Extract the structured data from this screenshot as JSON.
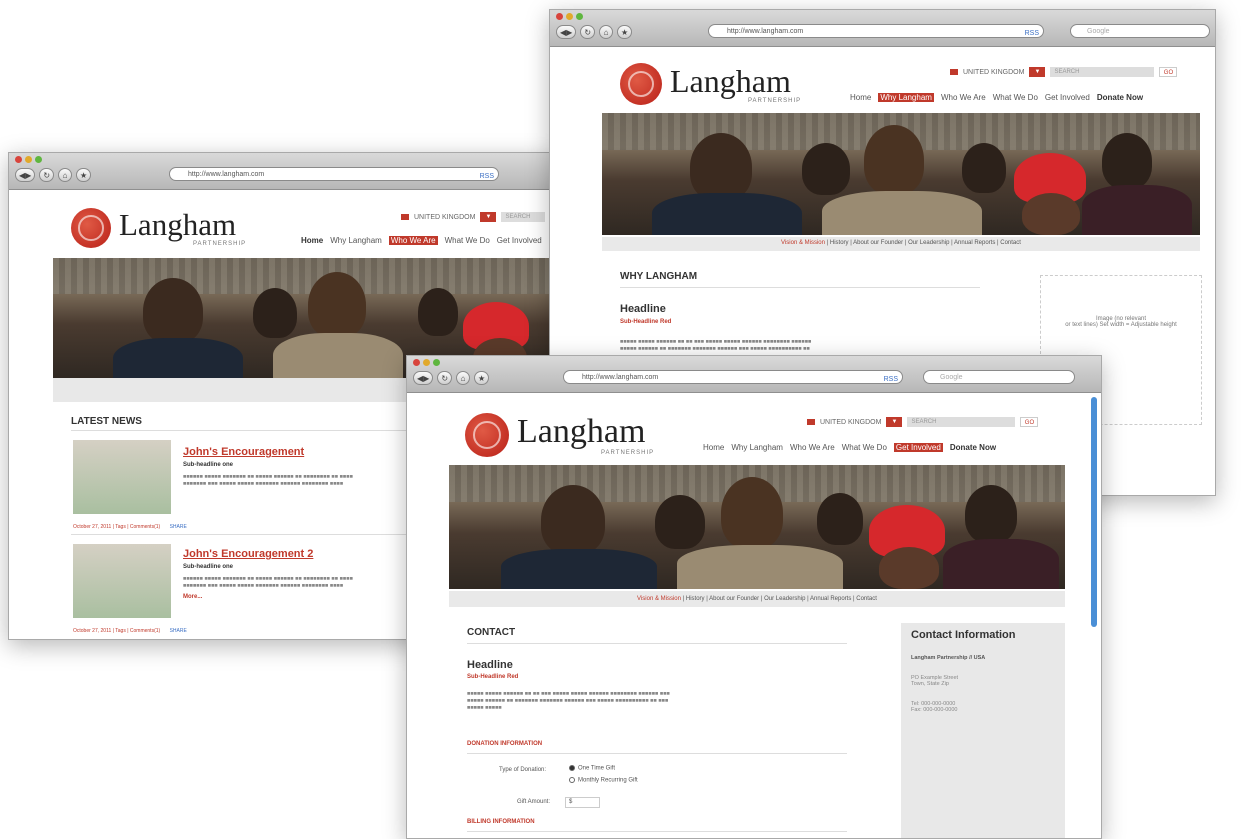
{
  "browser": {
    "urls": [
      "http://www.langham.com",
      "http://www.langham.com",
      "http://www.langham.com"
    ],
    "search_placeholder": "Google"
  },
  "site": {
    "brand": "Langham",
    "brand_sub": "PARTNERSHIP",
    "country": "UNITED KINGDOM",
    "search_placeholder": "SEARCH",
    "go_label": "GO",
    "nav": [
      "Home",
      "Why Langham",
      "Who We Are",
      "What We Do",
      "Get Involved",
      "Donate Now"
    ],
    "subnav": [
      "Vision & Mission",
      "History",
      "About our Founder",
      "Our Leadership",
      "Annual Reports",
      "Contact"
    ],
    "accent": "#c0392b"
  },
  "left_window": {
    "section_title": "LATEST NEWS",
    "news": [
      {
        "title": "John's Encouragement",
        "subtitle": "Sub-headline one",
        "meta": "October 27, 2011 | Tags | Comments(1)"
      },
      {
        "title": "John's Encouragement 2",
        "subtitle": "Sub-headline one",
        "meta": "October 27, 2011 | Tags | Comments(1)",
        "more": "More..."
      }
    ],
    "share_label": "SHARE"
  },
  "right_window": {
    "section_title": "WHY LANGHAM",
    "headline": "Headline",
    "subheadline": "Sub-Headline Red",
    "sidebar_text": "Image (no relevant\nor text lines) Set width = Adjustable height"
  },
  "front_window": {
    "section_title": "CONTACT",
    "headline": "Headline",
    "subheadline": "Sub-Headline Red",
    "donation_heading": "DONATION INFORMATION",
    "type_label": "Type of Donation:",
    "radio_options": [
      {
        "label": "One Time Gift",
        "selected": true
      },
      {
        "label": "Monthly Recurring Gift",
        "selected": false
      }
    ],
    "gift_label": "Gift Amount:",
    "gift_value": "$",
    "billing_heading": "BILLING INFORMATION",
    "contact_info_title": "Contact Information",
    "contact_org": "Langham Partnership // USA",
    "contact_address": "PO Example Street\nTown, State Zip",
    "contact_phone": "Tel: 000-000-0000\nFax: 000-000-0000"
  }
}
